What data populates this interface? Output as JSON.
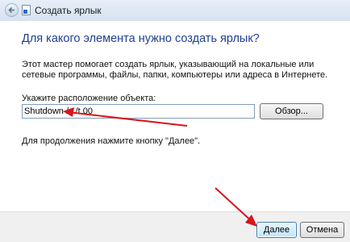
{
  "window": {
    "title": "Создать ярлык"
  },
  "main": {
    "heading": "Для какого элемента нужно создать ярлык?",
    "description": "Этот мастер помогает создать ярлык, указывающий на локальные или сетевые программы, файлы, папки, компьютеры или адреса в Интернете.",
    "location_label": "Укажите расположение объекта:",
    "location_value": "Shutdown /s /t 00",
    "browse_label": "Обзор...",
    "hint": "Для продолжения нажмите кнопку \"Далее\"."
  },
  "footer": {
    "next_label": "Далее",
    "cancel_label": "Отмена"
  },
  "colors": {
    "heading": "#1f3f92",
    "annotation_arrow": "#d9141b"
  }
}
